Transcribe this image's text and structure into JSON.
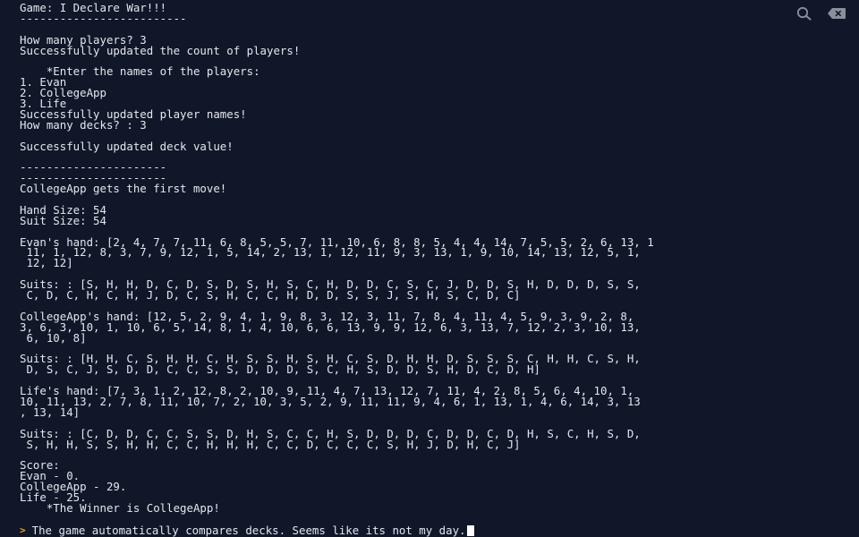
{
  "window": {
    "colors": {
      "background": "#101729",
      "text": "#e4e7ee",
      "prompt": "#f0a020",
      "icon": "#8a8f9c"
    }
  },
  "toolbar": {
    "search_icon": "search-icon",
    "clear_icon": "clear-console-icon"
  },
  "console": {
    "lines": [
      "Game: I Declare War!!!",
      "-------------------------",
      "",
      "How many players? 3",
      "Successfully updated the count of players!",
      "",
      "    *Enter the names of the players:",
      "1. Evan",
      "2. CollegeApp",
      "3. Life",
      "Successfully updated player names!",
      "How many decks? : 3",
      "",
      "Successfully updated deck value!",
      "",
      "----------------------",
      "----------------------",
      "CollegeApp gets the first move!",
      "",
      "Hand Size: 54",
      "Suit Size: 54",
      "",
      "Evan's hand: [2, 4, 7, 7, 11, 6, 8, 5, 5, 7, 11, 10, 6, 8, 8, 5, 4, 4, 14, 7, 5, 5, 2, 6, 13, 1",
      " 11, 1, 12, 8, 3, 7, 9, 12, 1, 5, 14, 2, 13, 1, 12, 11, 9, 3, 13, 1, 9, 10, 14, 13, 12, 5, 1,",
      " 12, 12]",
      "",
      "Suits: : [S, H, H, D, C, D, S, D, S, H, S, C, H, D, D, C, S, C, J, D, D, S, H, D, D, D, S, S,",
      " C, D, C, H, C, H, J, D, C, S, H, C, C, H, D, D, S, S, J, S, H, S, C, D, C]",
      "",
      "CollegeApp's hand: [12, 5, 2, 9, 4, 1, 9, 8, 3, 12, 3, 11, 7, 8, 4, 11, 4, 5, 9, 3, 9, 2, 8,",
      "3, 6, 3, 10, 1, 10, 6, 5, 14, 8, 1, 4, 10, 6, 6, 13, 9, 9, 12, 6, 3, 13, 7, 12, 2, 3, 10, 13,",
      " 6, 10, 8]",
      "",
      "Suits: : [H, H, C, S, H, H, C, H, S, S, H, S, H, C, S, D, H, H, D, S, S, S, C, H, H, C, S, H,",
      " D, S, C, J, S, D, D, C, C, S, S, D, D, D, S, C, H, S, D, D, S, H, D, C, D, H]",
      "",
      "Life's hand: [7, 3, 1, 2, 12, 8, 2, 10, 9, 11, 4, 7, 13, 12, 7, 11, 4, 2, 8, 5, 6, 4, 10, 1,",
      "10, 11, 13, 2, 7, 8, 11, 10, 7, 2, 10, 3, 5, 2, 9, 11, 11, 9, 4, 6, 1, 13, 1, 4, 6, 14, 3, 13",
      ", 13, 14]",
      "",
      "Suits: : [C, D, D, C, C, S, S, D, H, S, C, C, H, S, D, D, D, C, D, D, C, D, H, S, C, H, S, D,",
      " S, H, H, S, S, H, H, C, C, H, H, H, C, C, D, C, C, C, S, H, J, D, H, C, J]",
      "",
      "Score:",
      "Evan - 0.",
      "CollegeApp - 29.",
      "Life - 25.",
      "    *The Winner is CollegeApp!"
    ]
  },
  "prompt": {
    "glyph": ">",
    "input_text": "The game automatically compares decks. Seems like its not my day."
  }
}
